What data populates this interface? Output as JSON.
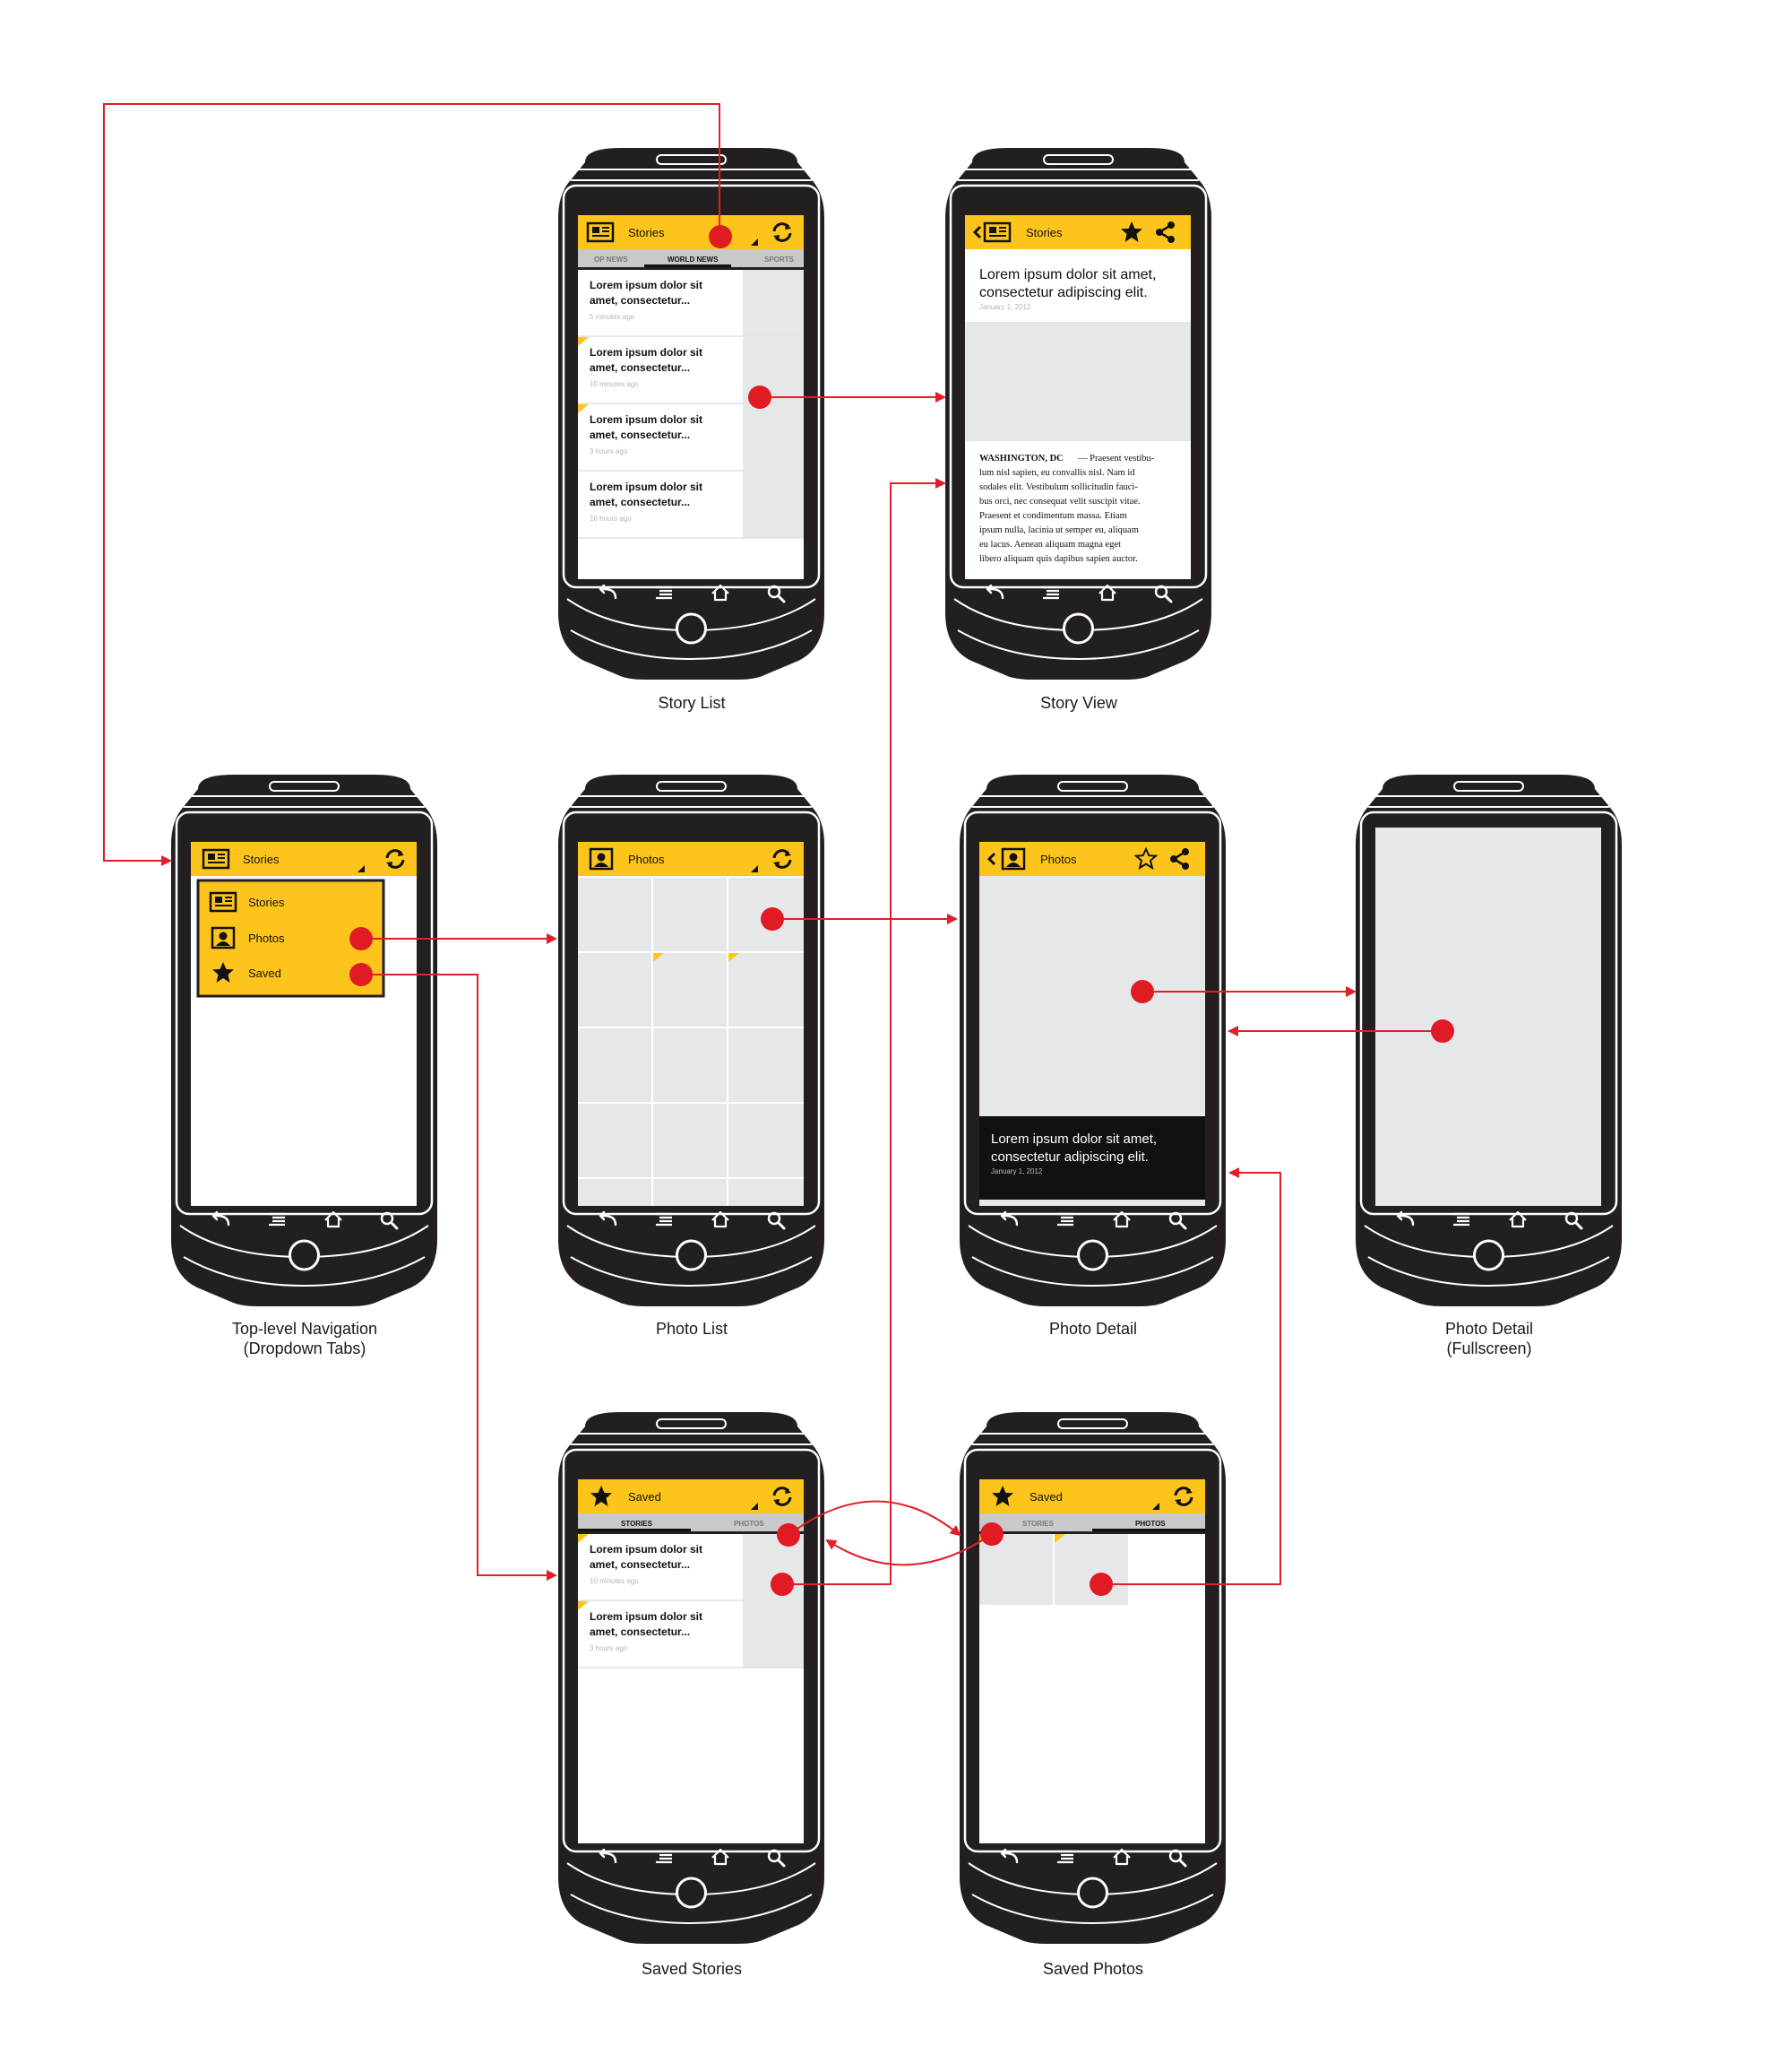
{
  "colors": {
    "accent": "#FDC51B",
    "phone_body": "#231f20",
    "placeholder": "#e6e7e8",
    "flow_arrow": "#e21f26",
    "hotspot": "#e01b24",
    "tab_bar": "#c9c9cb"
  },
  "icons": {
    "stories": "newspaper-icon",
    "photos": "portrait-icon",
    "saved": "star-icon",
    "refresh": "refresh-icon",
    "share": "share-icon",
    "back": "back-arrow-icon",
    "menu": "menu-icon",
    "home": "home-icon",
    "search": "search-icon"
  },
  "screens": {
    "story_list": {
      "caption": "Story List",
      "header_title": "Stories",
      "tabs": [
        "OP NEWS",
        "WORLD NEWS",
        "SPORTS"
      ],
      "items": [
        {
          "title_1": "Lorem ipsum dolor sit",
          "title_2": "amet, consectetur...",
          "time": "5 minutes ago"
        },
        {
          "title_1": "Lorem ipsum dolor sit",
          "title_2": "amet, consectetur...",
          "time": "10 minutes ago"
        },
        {
          "title_1": "Lorem ipsum dolor sit",
          "title_2": "amet, consectetur...",
          "time": "3 hours ago"
        },
        {
          "title_1": "Lorem ipsum dolor sit",
          "title_2": "amet, consectetur...",
          "time": "10 hours ago"
        }
      ]
    },
    "story_view": {
      "caption": "Story View",
      "header_title": "Stories",
      "headline_1": "Lorem ipsum dolor sit amet,",
      "headline_2": "consectetur adipiscing elit.",
      "date": "January 1, 2012",
      "dateline": "WASHINGTON, DC",
      "body_lines": [
        "— Praesent vestibu-",
        "lum nisl sapien, eu convallis nisl. Nam id",
        "sodales elit. Vestibulum sollicitudin fauci-",
        "bus orci, nec consequat velit suscipit vitae.",
        "Praesent et condimentum massa. Etiam",
        "ipsum nulla, lacinia ut semper eu, aliquam",
        "eu lacus. Aenean aliquam magna eget",
        "libero aliquam quis dapibus sapien auctor."
      ]
    },
    "top_nav": {
      "caption_1": "Top-level Navigation",
      "caption_2": "(Dropdown Tabs)",
      "header_title": "Stories",
      "menu": [
        "Stories",
        "Photos",
        "Saved"
      ]
    },
    "photo_list": {
      "caption": "Photo List",
      "header_title": "Photos"
    },
    "photo_detail": {
      "caption": "Photo Detail",
      "header_title": "Photos",
      "caption_1": "Lorem ipsum dolor sit amet,",
      "caption_2": "consectetur adipiscing elit.",
      "date": "January 1, 2012"
    },
    "photo_fullscreen": {
      "caption_1": "Photo Detail",
      "caption_2": "(Fullscreen)"
    },
    "saved_stories": {
      "caption": "Saved Stories",
      "header_title": "Saved",
      "tabs": [
        "STORIES",
        "PHOTOS"
      ],
      "items": [
        {
          "title_1": "Lorem ipsum dolor sit",
          "title_2": "amet, consectetur...",
          "time": "10 minutes ago"
        },
        {
          "title_1": "Lorem ipsum dolor sit",
          "title_2": "amet, consectetur...",
          "time": "3 hours ago"
        }
      ]
    },
    "saved_photos": {
      "caption": "Saved Photos",
      "header_title": "Saved",
      "tabs": [
        "STORIES",
        "PHOTOS"
      ]
    }
  }
}
